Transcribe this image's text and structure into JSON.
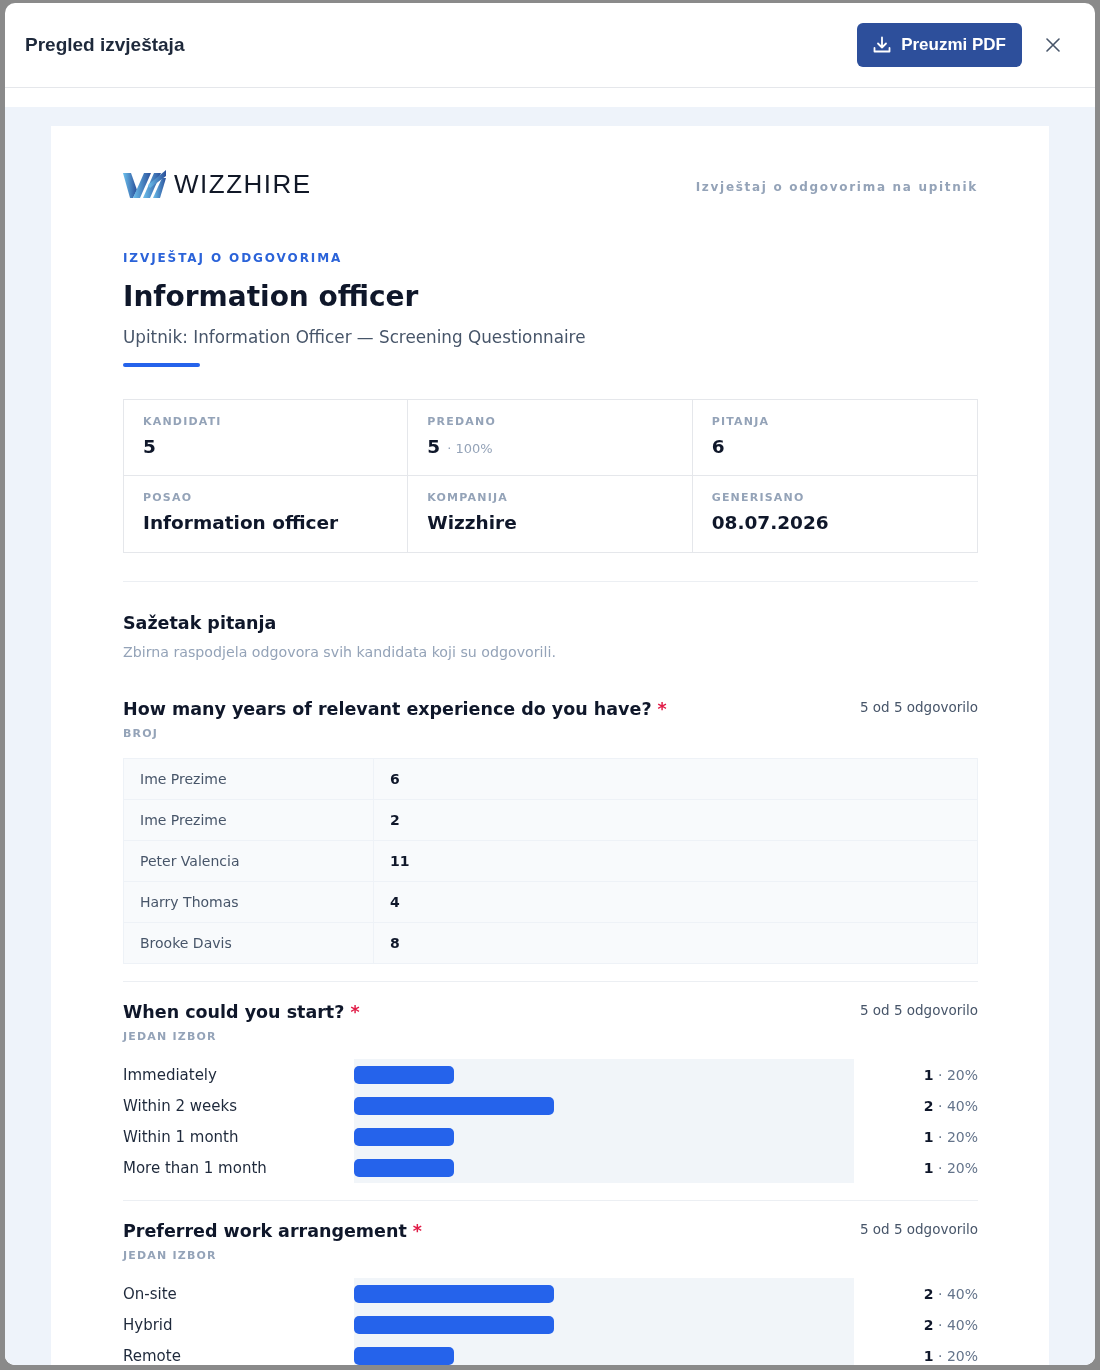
{
  "dialog": {
    "title": "Pregled izvještaja",
    "download_button": "Preuzmi PDF"
  },
  "report": {
    "brand": "WIZZHIRE",
    "header_caption": "Izvještaj o odgovorima na upitnik",
    "eyebrow": "IZVJEŠTAJ O ODGOVORIMA",
    "title": "Information officer",
    "subtitle": "Upitnik: Information Officer — Screening Questionnaire",
    "stats": [
      {
        "label": "KANDIDATI",
        "value": "5"
      },
      {
        "label": "PREDANO",
        "value": "5",
        "note": "· 100%"
      },
      {
        "label": "PITANJA",
        "value": "6"
      },
      {
        "label": "POSAO",
        "value": "Information officer"
      },
      {
        "label": "KOMPANIJA",
        "value": "Wizzhire"
      },
      {
        "label": "GENERISANO",
        "value": "08.07.2026"
      }
    ],
    "summary": {
      "title": "Sažetak pitanja",
      "description": "Zbirna raspodjela odgovora svih kandidata koji su odgovorili."
    },
    "questions": [
      {
        "kind": "number",
        "title": "How many years of relevant experience do you have?",
        "required_mark": "*",
        "answered": "5 od 5 odgovorilo",
        "type_label": "BROJ",
        "answers": [
          {
            "name": "Ime Prezime",
            "value": "6"
          },
          {
            "name": "Ime Prezime",
            "value": "2"
          },
          {
            "name": "Peter Valencia",
            "value": "11"
          },
          {
            "name": "Harry Thomas",
            "value": "4"
          },
          {
            "name": "Brooke Davis",
            "value": "8"
          }
        ]
      },
      {
        "kind": "single_choice",
        "title": "When could you start?",
        "required_mark": "*",
        "answered": "5 od 5 odgovorilo",
        "type_label": "JEDAN IZBOR",
        "options": [
          {
            "label": "Immediately",
            "level": 0.2,
            "result": "**1** · 20%"
          },
          {
            "label": "Within 2 weeks",
            "level": 0.4,
            "result": "**2** · 40%"
          },
          {
            "label": "Within 1 month",
            "level": 0.2,
            "result": "**1** · 20%"
          },
          {
            "label": "More than 1 month",
            "level": 0.2,
            "result": "**1** · 20%"
          }
        ]
      },
      {
        "kind": "single_choice",
        "title": "Preferred work arrangement",
        "required_mark": "*",
        "answered": "5 od 5 odgovorilo",
        "type_label": "JEDAN IZBOR",
        "options": [
          {
            "label": "On-site",
            "level": 0.4,
            "result": "**2** · 40%"
          },
          {
            "label": "Hybrid",
            "level": 0.4,
            "result": "**2** · 40%"
          },
          {
            "label": "Remote",
            "level": 0.2,
            "result": "**1** · 20%"
          }
        ]
      }
    ]
  }
}
